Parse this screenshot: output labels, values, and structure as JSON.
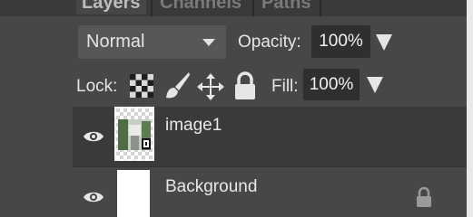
{
  "tabs": [
    {
      "label": "Layers"
    },
    {
      "label": "Channels"
    },
    {
      "label": "Paths"
    }
  ],
  "blend_mode": {
    "value": "Normal"
  },
  "opacity": {
    "label": "Opacity:",
    "value": "100%"
  },
  "lock": {
    "label": "Lock:"
  },
  "fill": {
    "label": "Fill:",
    "value": "100%"
  },
  "layers": [
    {
      "name": "image1",
      "selected": true
    },
    {
      "name": "Background",
      "selected": false,
      "locked": true
    }
  ],
  "colors": {
    "panel": "#474747",
    "selected_row": "#3a3a3a",
    "field": "#2f2f2f",
    "text": "#e6e6e6"
  }
}
